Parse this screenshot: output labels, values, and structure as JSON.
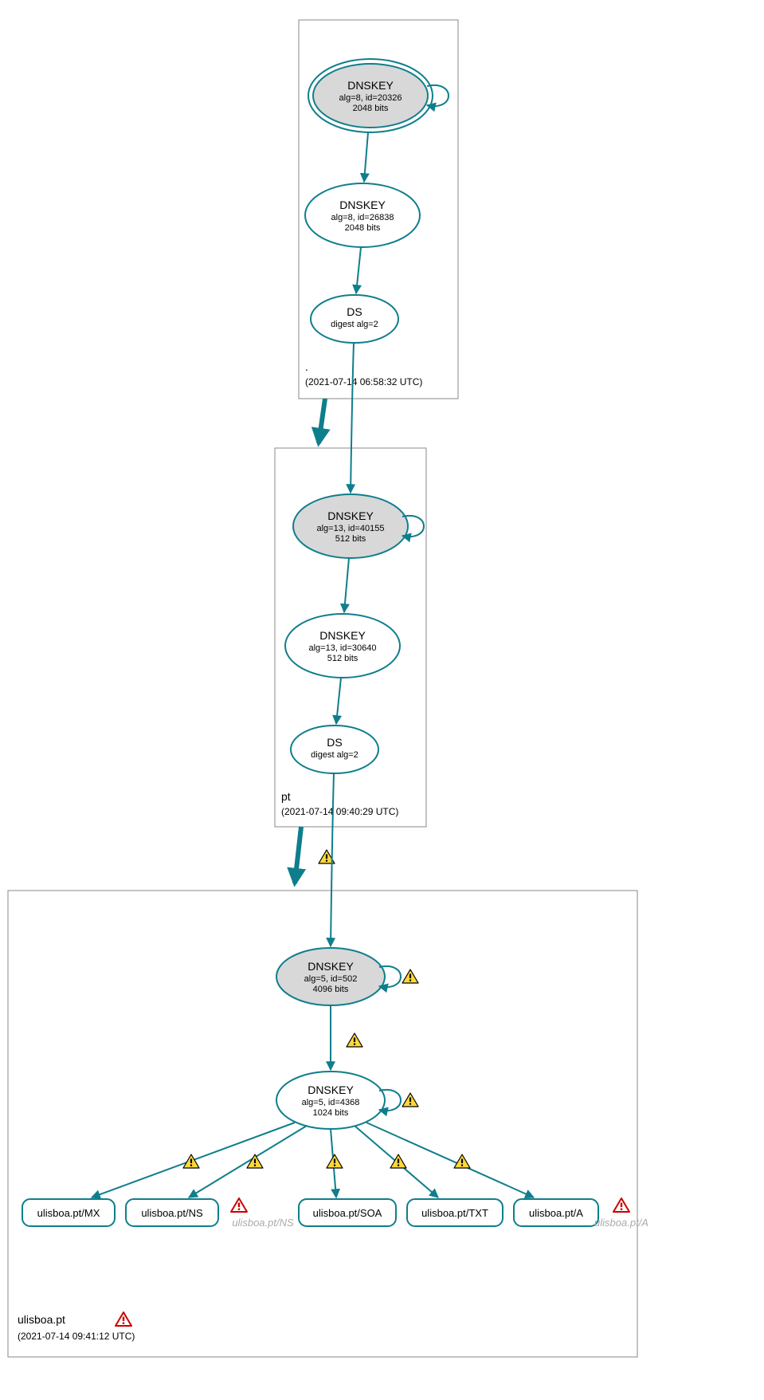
{
  "colors": {
    "stroke": "#0f7e8c",
    "ksk_fill": "#d8d8d8",
    "node_fill": "#ffffff",
    "warning_fill": "#ffd83a",
    "warning_stroke": "#000000",
    "error_stroke": "#cc0000"
  },
  "zones": [
    {
      "name": ".",
      "timestamp": "(2021-07-14 06:58:32 UTC)",
      "nodes": [
        {
          "id": "root-ksk",
          "type": "DNSKEY",
          "title": "DNSKEY",
          "line1": "alg=8, id=20326",
          "line2": "2048 bits",
          "ksk": true,
          "double_ring": true,
          "self_loop": true
        },
        {
          "id": "root-zsk",
          "type": "DNSKEY",
          "title": "DNSKEY",
          "line1": "alg=8, id=26838",
          "line2": "2048 bits",
          "ksk": false
        },
        {
          "id": "root-ds",
          "type": "DS",
          "title": "DS",
          "line1": "digest alg=2",
          "line2": ""
        }
      ]
    },
    {
      "name": "pt",
      "timestamp": "(2021-07-14 09:40:29 UTC)",
      "nodes": [
        {
          "id": "pt-ksk",
          "type": "DNSKEY",
          "title": "DNSKEY",
          "line1": "alg=13, id=40155",
          "line2": "512 bits",
          "ksk": true,
          "self_loop": true
        },
        {
          "id": "pt-zsk",
          "type": "DNSKEY",
          "title": "DNSKEY",
          "line1": "alg=13, id=30640",
          "line2": "512 bits",
          "ksk": false
        },
        {
          "id": "pt-ds",
          "type": "DS",
          "title": "DS",
          "line1": "digest alg=2",
          "line2": ""
        }
      ]
    },
    {
      "name": "ulisboa.pt",
      "timestamp": "(2021-07-14 09:41:12 UTC)",
      "zone_error": true,
      "nodes": [
        {
          "id": "ul-ksk",
          "type": "DNSKEY",
          "title": "DNSKEY",
          "line1": "alg=5, id=502",
          "line2": "4096 bits",
          "ksk": true,
          "self_loop": true,
          "self_loop_warning": true
        },
        {
          "id": "ul-zsk",
          "type": "DNSKEY",
          "title": "DNSKEY",
          "line1": "alg=5, id=4368",
          "line2": "1024 bits",
          "ksk": false,
          "self_loop": true,
          "self_loop_warning": true
        }
      ],
      "rrsets": [
        {
          "label": "ulisboa.pt/MX"
        },
        {
          "label": "ulisboa.pt/NS"
        },
        {
          "label": "ulisboa.pt/SOA"
        },
        {
          "label": "ulisboa.pt/TXT"
        },
        {
          "label": "ulisboa.pt/A"
        }
      ],
      "ghost_rrsets": [
        {
          "label": "ulisboa.pt/NS",
          "error": true
        },
        {
          "label": "ulisboa.pt/A",
          "error": true
        }
      ]
    }
  ],
  "edges": [
    {
      "from": "root-ksk",
      "to": "root-zsk"
    },
    {
      "from": "root-zsk",
      "to": "root-ds"
    },
    {
      "from": "root-ds",
      "to": "pt-ksk"
    },
    {
      "from": "root-zone",
      "to": "pt-zone",
      "thick": true
    },
    {
      "from": "pt-ksk",
      "to": "pt-zsk"
    },
    {
      "from": "pt-zsk",
      "to": "pt-ds"
    },
    {
      "from": "pt-ds",
      "to": "ul-ksk"
    },
    {
      "from": "pt-zone",
      "to": "ul-zone",
      "thick": true,
      "warning": true
    },
    {
      "from": "ul-ksk",
      "to": "ul-zsk",
      "warning": true
    },
    {
      "from": "ul-zsk",
      "to": "rr-mx",
      "warning": true
    },
    {
      "from": "ul-zsk",
      "to": "rr-ns",
      "warning": true
    },
    {
      "from": "ul-zsk",
      "to": "rr-soa",
      "warning": true
    },
    {
      "from": "ul-zsk",
      "to": "rr-txt",
      "warning": true
    },
    {
      "from": "ul-zsk",
      "to": "rr-a",
      "warning": true
    }
  ],
  "chart_data": {
    "type": "diagram",
    "description": "DNSSEC chain-of-trust graph from root (.) through pt down to ulisboa.pt, showing DNSKEY and DS records, with warning and error badges on the ulisboa.pt delegation and RRsets.",
    "zones": [
      {
        "zone": ".",
        "ksk": {
          "alg": 8,
          "id": 20326,
          "bits": 2048
        },
        "zsk": {
          "alg": 8,
          "id": 26838,
          "bits": 2048
        },
        "ds": {
          "digest_alg": 2
        },
        "timestamp": "2021-07-14 06:58:32 UTC"
      },
      {
        "zone": "pt",
        "ksk": {
          "alg": 13,
          "id": 40155,
          "bits": 512
        },
        "zsk": {
          "alg": 13,
          "id": 30640,
          "bits": 512
        },
        "ds": {
          "digest_alg": 2
        },
        "timestamp": "2021-07-14 09:40:29 UTC"
      },
      {
        "zone": "ulisboa.pt",
        "ksk": {
          "alg": 5,
          "id": 502,
          "bits": 4096
        },
        "zsk": {
          "alg": 5,
          "id": 4368,
          "bits": 1024
        },
        "rrsets": [
          "MX",
          "NS",
          "SOA",
          "TXT",
          "A"
        ],
        "insecure_rrsets": [
          "NS",
          "A"
        ],
        "timestamp": "2021-07-14 09:41:12 UTC",
        "status": "warnings+errors"
      }
    ]
  }
}
